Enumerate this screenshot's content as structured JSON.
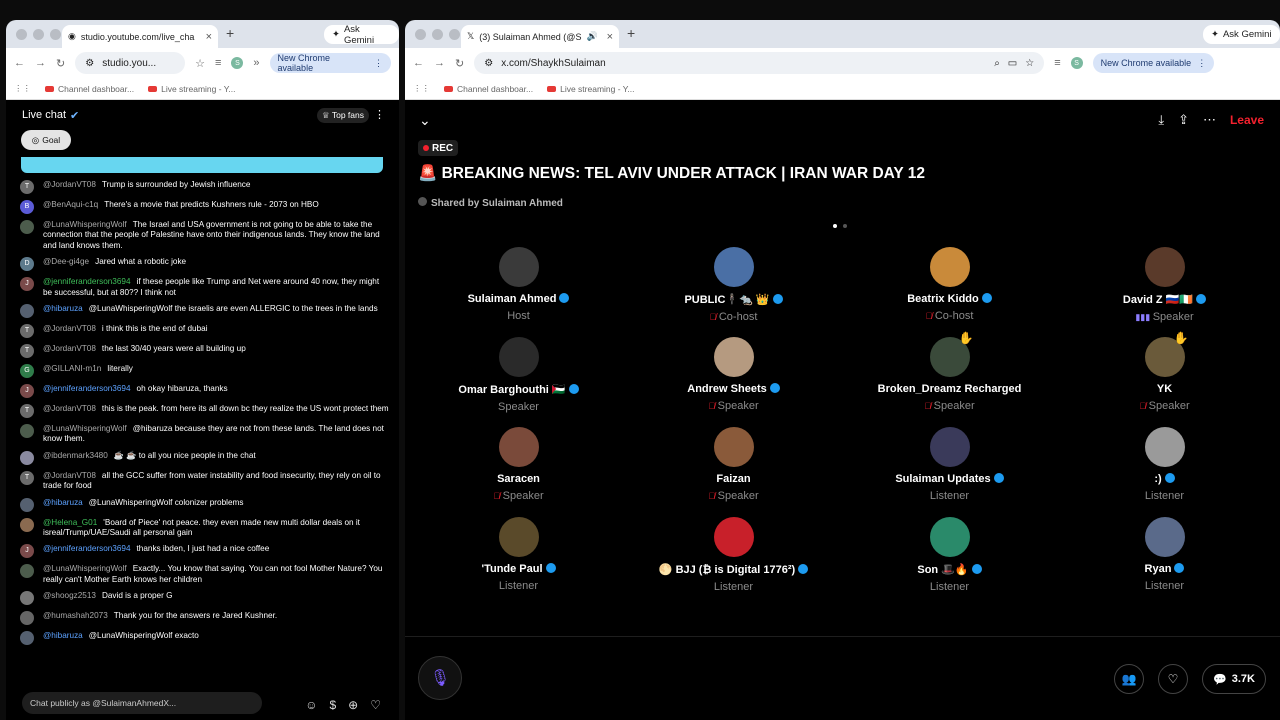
{
  "left": {
    "tab_title": "studio.youtube.com/live_cha",
    "url": "studio.you...",
    "ask_gemini": "Ask Gemini",
    "chrome_available": "New Chrome available",
    "bookmarks": [
      "Channel dashboar...",
      "Live streaming - Y..."
    ],
    "chat_title": "Live chat",
    "top_fans": "Top fans",
    "goal": "Goal",
    "input_placeholder": "Chat publicly as @SulaimanAhmedX...",
    "messages": [
      {
        "user": "@JordanVT08",
        "text": "Trump is surrounded by Jewish influence",
        "initial": "T",
        "color": "#6b6b6b",
        "style": ""
      },
      {
        "user": "@BenAqui-c1q",
        "text": "There's a movie that predicts Kushners rule - 2073 on HBO",
        "initial": "B",
        "color": "#5b5bd6",
        "style": ""
      },
      {
        "user": "@LunaWhisperingWolf",
        "text": "The Israel and USA government is not going to be able to take the connection that the people of Palestine have onto their indigenous lands. They know the land and land knows them.",
        "initial": "",
        "color": "#4c5c4c",
        "style": ""
      },
      {
        "user": "@Dee-gi4ge",
        "text": "Jared what a robotic joke",
        "initial": "D",
        "color": "#5d7a8c",
        "style": ""
      },
      {
        "user": "@jenniferanderson3694",
        "text": "if these people like Trump and Net were around 40 now, they might be successful, but at 80?? I think not",
        "initial": "J",
        "color": "#7a4a4a",
        "style": "green"
      },
      {
        "user": "@hibaruza",
        "text": "@LunaWhisperingWolf the israelis are even ALLERGIC to the trees in the lands",
        "initial": "",
        "color": "#556070",
        "style": "blue"
      },
      {
        "user": "@JordanVT08",
        "text": "i think this is the end of dubai",
        "initial": "T",
        "color": "#6b6b6b",
        "style": ""
      },
      {
        "user": "@JordanVT08",
        "text": "the last 30/40 years were all building up",
        "initial": "T",
        "color": "#6b6b6b",
        "style": ""
      },
      {
        "user": "@GILLANI-m1n",
        "text": "literally",
        "initial": "G",
        "color": "#2f7d4a",
        "style": ""
      },
      {
        "user": "@jenniferanderson3694",
        "text": "oh okay hibaruza, thanks",
        "initial": "J",
        "color": "#7a4a4a",
        "style": "blue"
      },
      {
        "user": "@JordanVT08",
        "text": "this is the peak. from here its all down bc they realize the US wont protect them",
        "initial": "T",
        "color": "#6b6b6b",
        "style": ""
      },
      {
        "user": "@LunaWhisperingWolf",
        "text": "@hibaruza because they are not from these lands. The land does not know them.",
        "initial": "",
        "color": "#4c5c4c",
        "style": ""
      },
      {
        "user": "@ibdenmark3480",
        "text": "☕ ☕ to all you nice people in the chat",
        "initial": "",
        "color": "#8a8aa0",
        "style": ""
      },
      {
        "user": "@JordanVT08",
        "text": "all the GCC suffer from water instability and food insecurity, they rely on oil to trade for food",
        "initial": "T",
        "color": "#6b6b6b",
        "style": ""
      },
      {
        "user": "@hibaruza",
        "text": "@LunaWhisperingWolf colonizer problems",
        "initial": "",
        "color": "#556070",
        "style": "blue"
      },
      {
        "user": "@Helena_G01",
        "text": "'Board of Piece' not peace. they even made new multi dollar deals on it isreal/Trump/UAE/Saudi all personal gain",
        "initial": "",
        "color": "#8a6a50",
        "style": "green"
      },
      {
        "user": "@jenniferanderson3694",
        "text": "thanks ibden, I just had a nice coffee",
        "initial": "J",
        "color": "#7a4a4a",
        "style": "blue"
      },
      {
        "user": "@LunaWhisperingWolf",
        "text": "Exactly... You know that saying. You can not fool Mother Nature? You really can't Mother Earth knows her children",
        "initial": "",
        "color": "#4c5c4c",
        "style": ""
      },
      {
        "user": "@shoogz2513",
        "text": "David is a proper G",
        "initial": "",
        "color": "#777",
        "style": ""
      },
      {
        "user": "@humashah2073",
        "text": "Thank you for the answers re Jared Kushner.",
        "initial": "",
        "color": "#666",
        "style": ""
      },
      {
        "user": "@hibaruza",
        "text": "@LunaWhisperingWolf exacto",
        "initial": "",
        "color": "#556070",
        "style": "blue"
      }
    ]
  },
  "right": {
    "tab_title": "(3) Sulaiman Ahmed (@S",
    "url": "x.com/ShaykhSulaiman",
    "ask_gemini": "Ask Gemini",
    "chrome_available": "New Chrome available",
    "bookmarks": [
      "Channel dashboar...",
      "Live streaming - Y..."
    ],
    "leave": "Leave",
    "rec": "REC",
    "title": "🚨 BREAKING NEWS: TEL AVIV UNDER ATTACK | IRAN WAR DAY 12",
    "shared_by": "Shared by Sulaiman Ahmed",
    "reply_count": "3.7K",
    "participants": [
      {
        "name": "Sulaiman Ahmed",
        "role": "Host",
        "verified": true,
        "icon": "",
        "color": "#3a3a3a",
        "hand": ""
      },
      {
        "name": "PUBLIC🕴🏻🐀 👑",
        "role": "Co-host",
        "verified": true,
        "icon": "mute",
        "color": "#4a6fa5",
        "hand": ""
      },
      {
        "name": "Beatrix Kiddo",
        "role": "Co-host",
        "verified": true,
        "icon": "mute",
        "color": "#c98a3a",
        "hand": ""
      },
      {
        "name": "David Z 🇷🇺🇮🇪",
        "role": "Speaker",
        "verified": true,
        "icon": "bars",
        "color": "#5a3a2a",
        "hand": ""
      },
      {
        "name": "Omar Barghouthi 🇵🇸",
        "role": "Speaker",
        "verified": true,
        "icon": "",
        "color": "#2a2a2a",
        "hand": ""
      },
      {
        "name": "Andrew Sheets",
        "role": "Speaker",
        "verified": true,
        "icon": "mute",
        "color": "#b59a80",
        "hand": ""
      },
      {
        "name": "Broken_Dreamz Recharged",
        "role": "Speaker",
        "verified": false,
        "icon": "mute",
        "color": "#3a4a3a",
        "hand": "✋"
      },
      {
        "name": "YK",
        "role": "Speaker",
        "verified": false,
        "icon": "mute",
        "color": "#6a5a3a",
        "hand": "✋"
      },
      {
        "name": "Saracen",
        "role": "Speaker",
        "verified": false,
        "icon": "mute",
        "color": "#7a4a3a",
        "hand": ""
      },
      {
        "name": "Faizan",
        "role": "Speaker",
        "verified": false,
        "icon": "mute",
        "color": "#8a5a3a",
        "hand": ""
      },
      {
        "name": "Sulaiman Updates",
        "role": "Listener",
        "verified": true,
        "icon": "",
        "color": "#3a3a5a",
        "hand": ""
      },
      {
        "name": ":)",
        "role": "Listener",
        "verified": true,
        "icon": "",
        "color": "#9a9a9a",
        "hand": ""
      },
      {
        "name": "'Tunde Paul",
        "role": "Listener",
        "verified": true,
        "icon": "",
        "color": "#5a4a2a",
        "hand": ""
      },
      {
        "name": "🌕 BJJ (₿ is Digital 1776²)",
        "role": "Listener",
        "verified": true,
        "icon": "",
        "color": "#c8202a",
        "hand": ""
      },
      {
        "name": "Son 🎩🔥",
        "role": "Listener",
        "verified": true,
        "icon": "",
        "color": "#2a8a6a",
        "hand": ""
      },
      {
        "name": "Ryan",
        "role": "Listener",
        "verified": true,
        "icon": "",
        "color": "#5a6a8a",
        "hand": ""
      }
    ]
  }
}
